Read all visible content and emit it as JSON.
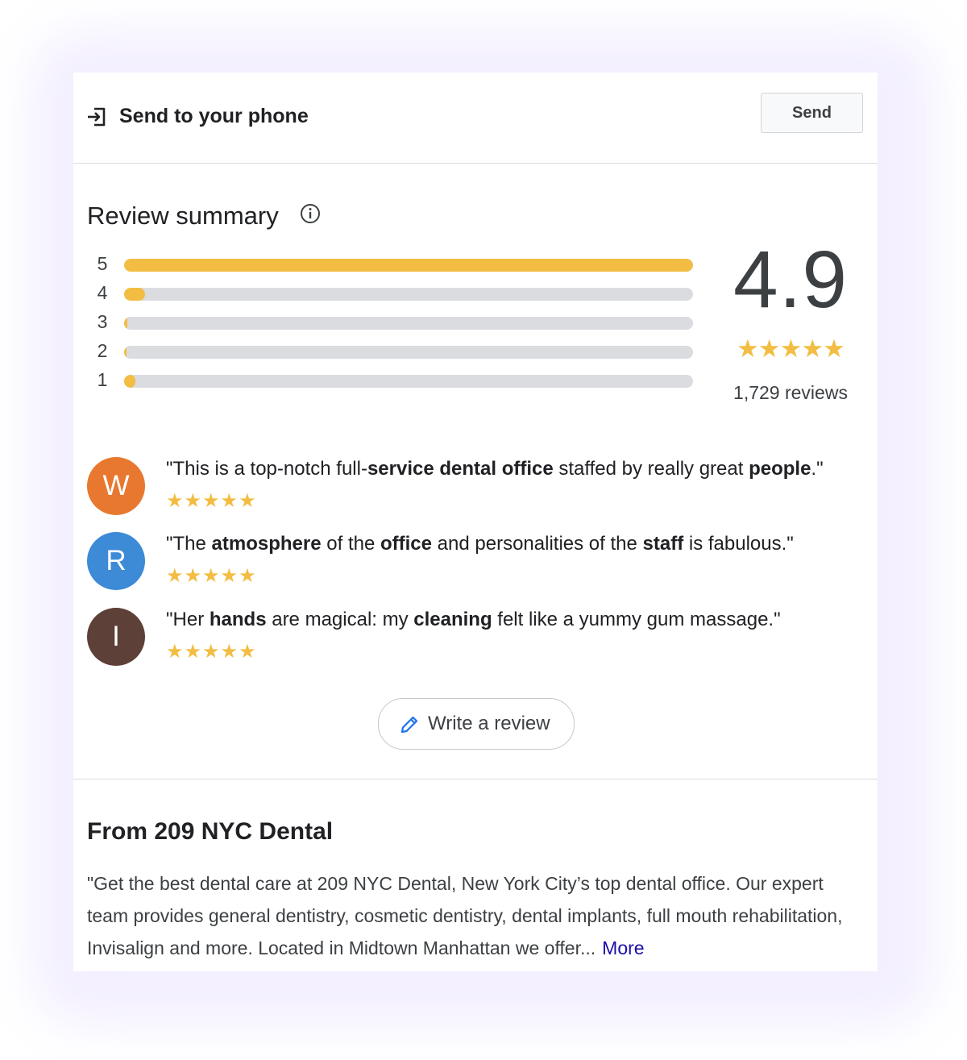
{
  "send_row": {
    "title": "Send to your phone",
    "button_label": "Send"
  },
  "review_summary": {
    "title": "Review summary",
    "bars": [
      {
        "label": "5",
        "fill_fraction": 1.0
      },
      {
        "label": "4",
        "fill_fraction": 0.037
      },
      {
        "label": "3",
        "fill_fraction": 0.006
      },
      {
        "label": "2",
        "fill_fraction": 0.004
      },
      {
        "label": "1",
        "fill_fraction": 0.02
      }
    ],
    "rating": "4.9",
    "stars": "★★★★★",
    "review_count": "1,729 reviews",
    "bar_color": "#f2bd42",
    "track_color": "#dadce0"
  },
  "reviews": [
    {
      "initial": "W",
      "avatar_color": "#e8782f",
      "stars": "★★★★★",
      "quote_parts": [
        {
          "text": "\"This is a top-notch full-",
          "bold": false
        },
        {
          "text": "service dental office",
          "bold": true
        },
        {
          "text": " staffed by really great ",
          "bold": false
        },
        {
          "text": "people",
          "bold": true
        },
        {
          "text": ".\"",
          "bold": false
        }
      ]
    },
    {
      "initial": "R",
      "avatar_color": "#3d8ad7",
      "stars": "★★★★★",
      "quote_parts": [
        {
          "text": "\"The ",
          "bold": false
        },
        {
          "text": "atmosphere",
          "bold": true
        },
        {
          "text": " of the ",
          "bold": false
        },
        {
          "text": "office",
          "bold": true
        },
        {
          "text": " and personalities of the ",
          "bold": false
        },
        {
          "text": "staff",
          "bold": true
        },
        {
          "text": " is fabulous.\"",
          "bold": false
        }
      ]
    },
    {
      "initial": "I",
      "avatar_color": "#5d4037",
      "stars": "★★★★★",
      "quote_parts": [
        {
          "text": "\"Her ",
          "bold": false
        },
        {
          "text": "hands",
          "bold": true
        },
        {
          "text": " are magical: my ",
          "bold": false
        },
        {
          "text": "cleaning",
          "bold": true
        },
        {
          "text": " felt like a yummy gum massage.\"",
          "bold": false
        }
      ]
    }
  ],
  "write_review": {
    "label": "Write a review",
    "icon": "pencil-icon"
  },
  "from_section": {
    "title": "From 209 NYC Dental",
    "description": "\"Get the best dental care at 209 NYC Dental, New York City’s top dental office. Our expert team provides general dentistry, cosmetic dentistry, dental implants, full mouth rehabilitation, Invisalign and more. Located in Midtown Manhattan we offer...",
    "more_label": "More",
    "link_color": "#1a0dab"
  }
}
